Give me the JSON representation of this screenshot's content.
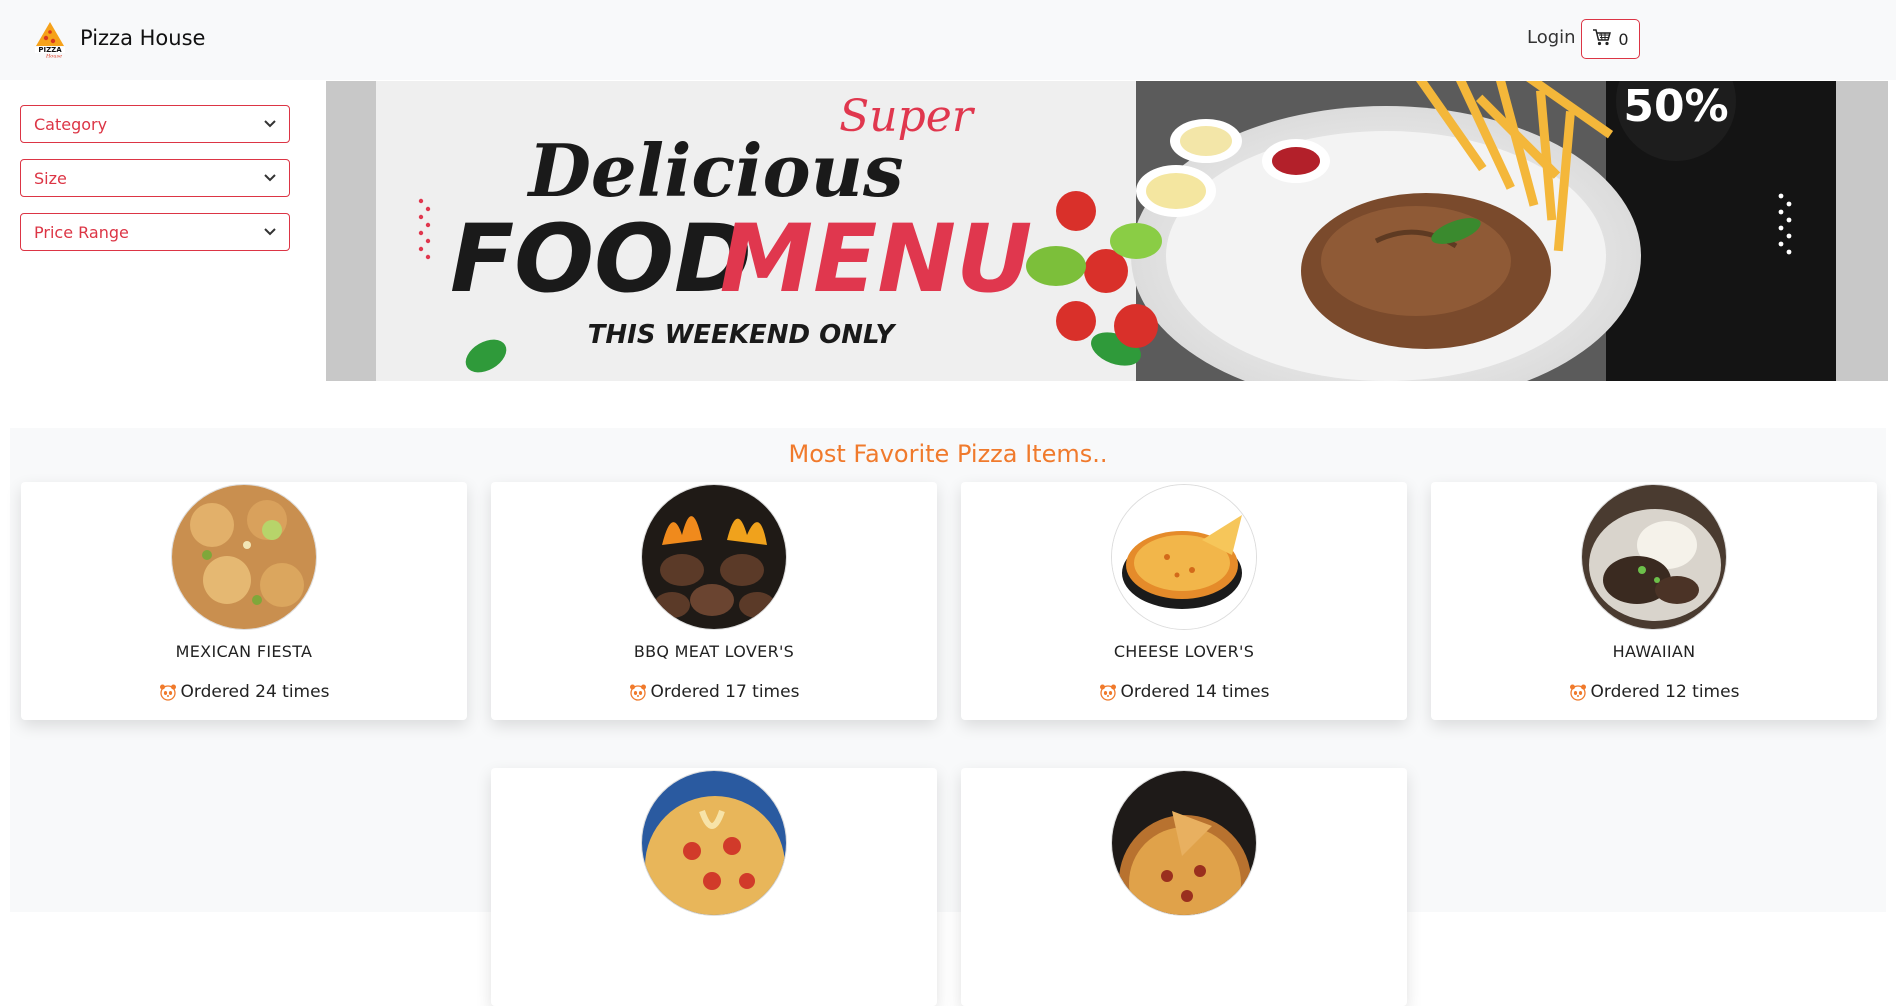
{
  "header": {
    "brand": "Pizza House",
    "logo_icon": "pizza-logo-icon",
    "login_label": "Login",
    "cart_icon": "cart-icon",
    "cart_count": "0"
  },
  "filters": [
    {
      "label": "Category"
    },
    {
      "label": "Size"
    },
    {
      "label": "Price Range"
    }
  ],
  "banner": {
    "line1": "Super",
    "line2": "Delicious",
    "line3a": "FOOD",
    "line3b": "MENU",
    "line4": "THIS WEEKEND ONLY",
    "corner": "50%"
  },
  "favorites": {
    "title": "Most Favorite Pizza Items..",
    "items": [
      {
        "name": "MEXICAN FIESTA",
        "orders": "Ordered 24 times"
      },
      {
        "name": "BBQ MEAT LOVER'S",
        "orders": "Ordered 17 times"
      },
      {
        "name": "CHEESE LOVER'S",
        "orders": "Ordered 14 times"
      },
      {
        "name": "HAWAIIAN",
        "orders": "Ordered 12 times"
      },
      {
        "name": "",
        "orders": ""
      },
      {
        "name": "",
        "orders": ""
      }
    ]
  },
  "colors": {
    "accent_red": "#dc3545",
    "title_orange": "#f07a2c",
    "header_bg": "#f8f9fa"
  }
}
